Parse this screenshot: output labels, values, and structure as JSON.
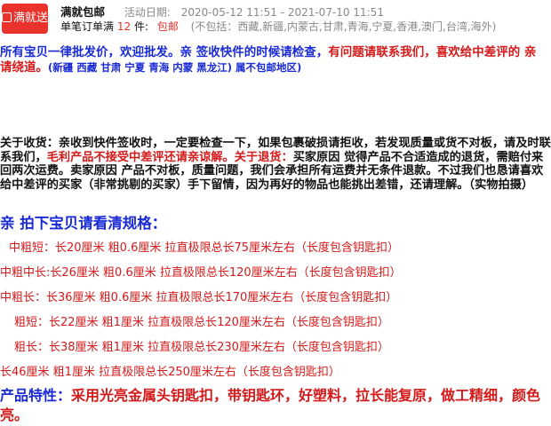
{
  "promo": {
    "badge_text": "满就送",
    "title": "满就包邮",
    "period_label": "活动日期:",
    "period_dates": "2020-05-12 11:51 - 2021-07-10 11:51",
    "rule_prefix": "单笔订单满",
    "rule_count": "12",
    "rule_unit": "件:",
    "reward": "包邮",
    "exclusion": "(不包括：西藏,新疆,内蒙古,甘肃,青海,宁夏,香港,澳门,台湾,海外)"
  },
  "notice": {
    "blue_part": "所有宝贝一律批发价，欢迎批发。亲 签收快件的时候请检查，",
    "red_part": "有问题请联系我们，喜欢给中差评的 亲 请绕道。",
    "blue_small": "(新疆 西藏 甘肃 宁夏 青海 内蒙 黑龙江) 属不包邮地区)"
  },
  "receipt": {
    "text_a": "关于收货：亲收到快件签收时，一定要检查一下，如果包裹破损请拒收，若发现质量或货不对板，请及时联系我们，",
    "text_red": "毛利产品不接受中差评还请亲谅解。关于退货：",
    "text_b": "买家原因 觉得产品不合适造成的退货，需赔付来回两次运费。卖家原因 产品不对板，质量问题，我们会承担所有运费并无条件退款。不过我们也恳请喜欢给中差评的买家（非常挑剔的买家）手下留情，因为再好的物品也能挑出差错，还请理解。（实物拍摄）"
  },
  "spec_title": "亲 拍下宝贝请看清规格：",
  "specs": [
    "中粗短：长20厘米 粗0.6厘米 拉直极限总长75厘米左右（长度包含钥匙扣）",
    "中粗中长:长26厘米 粗0.6厘米 拉直极限总长120厘米左右（长度包含钥匙扣）",
    "中粗长：长36厘米 粗0.6厘米 拉直极限总长170厘米左右（长度包含钥匙扣）",
    "粗短：长22厘米  粗1厘米 拉直极限总长120厘米左右（长度包含钥匙扣）",
    "粗长：长38厘米 粗1厘米 拉直极限总长230厘米左右（长度包含钥匙扣）",
    "长46厘米  粗1厘米 拉直极限总长250厘米左右（长度包含钥匙扣）"
  ],
  "features": {
    "label": "产品特性：",
    "text": "采用光亮金属头钥匙扣，带钥匙环，好塑料，拉长能复原，做工精细，颜色亮。"
  }
}
